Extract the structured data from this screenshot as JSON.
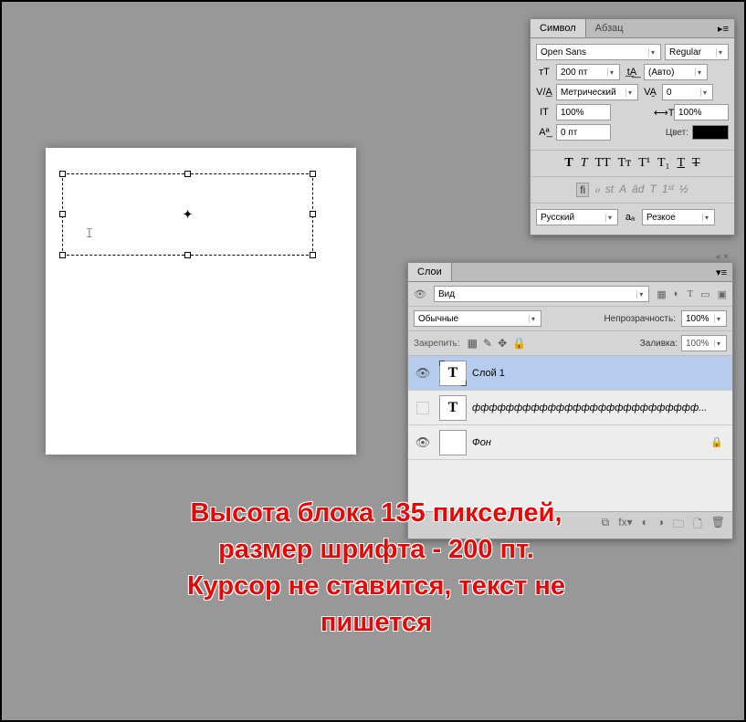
{
  "annotation": {
    "line1": "Высота блока 135 пикселей,",
    "line2": "размер шрифта - 200 пт.",
    "line3": "Курсор не ставится, текст не",
    "line4": "пишется"
  },
  "char_panel": {
    "tab_symbol": "Символ",
    "tab_paragraph": "Абзац",
    "font_family": "Open Sans",
    "font_style": "Regular",
    "font_size": "200 пт",
    "leading": "(Авто)",
    "kerning": "Метрический",
    "tracking": "0",
    "vscale": "100%",
    "hscale": "100%",
    "baseline": "0 пт",
    "color_label": "Цвет:",
    "language": "Русский",
    "aa_label": "aₐ",
    "aa_mode": "Резкое",
    "style_bold": "T",
    "style_italic": "T",
    "style_caps": "TT",
    "style_small": "Tт",
    "style_sup": "T¹",
    "style_sub": "T₁",
    "style_under": "T",
    "style_strike": "T",
    "ot_fi": "fi",
    "ot_o": "ℴ",
    "ot_st": "st",
    "ot_a": "A",
    "ot_ad": "ād",
    "ot_t": "T",
    "ot_1st": "1ˢᵗ",
    "ot_half": "½"
  },
  "layers_panel": {
    "title": "Слои",
    "view": "Вид",
    "blend_mode": "Обычные",
    "opacity_label": "Непрозрачность:",
    "opacity": "100%",
    "lock_label": "Закрепить:",
    "fill_label": "Заливка:",
    "fill": "100%",
    "layers": [
      {
        "name": "Слой 1",
        "type": "T",
        "selected": true,
        "visible": true
      },
      {
        "name": "ффффффффффффффффффффффффффф...",
        "type": "T",
        "selected": false,
        "visible": false
      },
      {
        "name": "Фон",
        "type": "bg",
        "selected": false,
        "visible": true,
        "locked": true
      }
    ]
  }
}
